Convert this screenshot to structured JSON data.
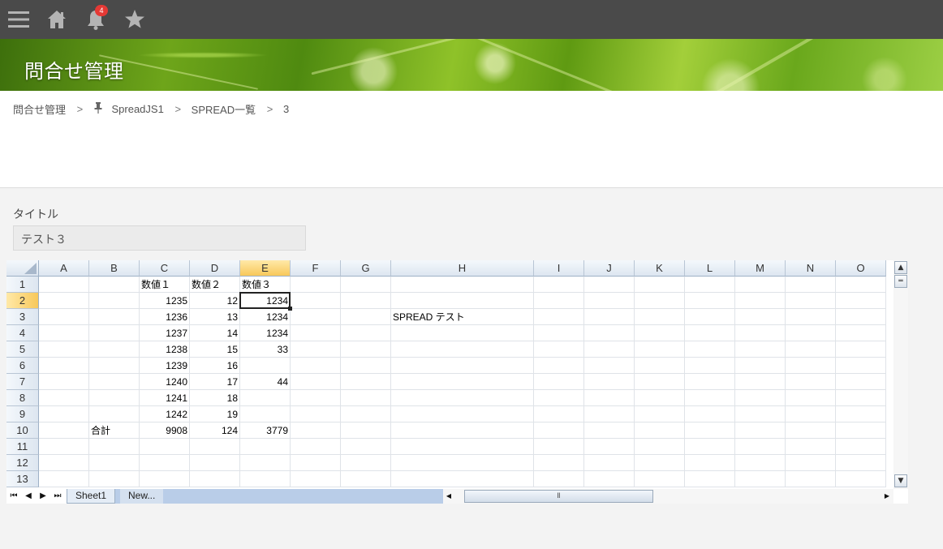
{
  "topbar": {
    "notification_count": "4",
    "icons": [
      "menu-icon",
      "home-icon",
      "bell-icon",
      "star-icon"
    ]
  },
  "page": {
    "title": "問合せ管理"
  },
  "breadcrumb": {
    "items": [
      "問合せ管理",
      "SpreadJS1",
      "SPREAD一覧",
      "3"
    ],
    "separator": ">"
  },
  "form": {
    "title_label": "タイトル",
    "title_value": "テスト３"
  },
  "spreadsheet": {
    "columns": [
      "A",
      "B",
      "C",
      "D",
      "E",
      "F",
      "G",
      "H",
      "I",
      "J",
      "K",
      "L",
      "M",
      "N",
      "O"
    ],
    "selected_column": "E",
    "rows": [
      "1",
      "2",
      "3",
      "4",
      "5",
      "6",
      "7",
      "8",
      "9",
      "10",
      "11",
      "12",
      "13"
    ],
    "selected_row": "2",
    "active_cell": "E2",
    "cells": {
      "C1": "数値１",
      "D1": "数値２",
      "E1": "数値３",
      "C2": "1235",
      "D2": "12",
      "E2": "1234",
      "C3": "1236",
      "D3": "13",
      "E3": "1234",
      "H3": "SPREAD テスト",
      "C4": "1237",
      "D4": "14",
      "E4": "1234",
      "C5": "1238",
      "D5": "15",
      "E5": "33",
      "C6": "1239",
      "D6": "16",
      "C7": "1240",
      "D7": "17",
      "E7": "44",
      "C8": "1241",
      "D8": "18",
      "C9": "1242",
      "D9": "19",
      "B10": "合計",
      "C10": "9908",
      "D10": "124",
      "E10": "3779"
    },
    "sheet_tabs": [
      "Sheet1",
      "New..."
    ],
    "active_sheet": "Sheet1"
  },
  "colors": {
    "topbar": "#4a4a4a",
    "badge": "#e53935",
    "selected_header": "#f8c85a",
    "header": "#dde6f0",
    "tab_strip": "#b9cde8"
  }
}
